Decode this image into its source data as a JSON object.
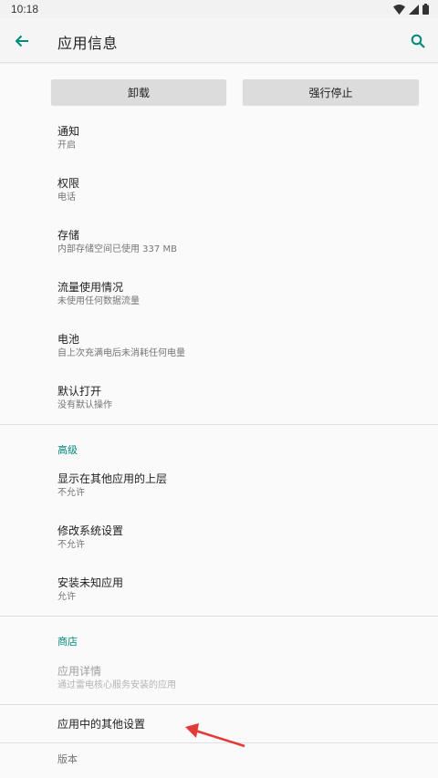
{
  "status_bar": {
    "time": "10:18"
  },
  "app_bar": {
    "title": "应用信息"
  },
  "buttons": {
    "uninstall": "卸载",
    "force_stop": "强行停止"
  },
  "items": [
    {
      "title": "通知",
      "subtitle": "开启"
    },
    {
      "title": "权限",
      "subtitle": "电话"
    },
    {
      "title": "存储",
      "subtitle": "内部存储空间已使用 337 MB"
    },
    {
      "title": "流量使用情况",
      "subtitle": "未使用任何数据流量"
    },
    {
      "title": "电池",
      "subtitle": "自上次充满电后未消耗任何电量"
    },
    {
      "title": "默认打开",
      "subtitle": "没有默认操作"
    }
  ],
  "advanced": {
    "header": "高级",
    "items": [
      {
        "title": "显示在其他应用的上层",
        "subtitle": "不允许"
      },
      {
        "title": "修改系统设置",
        "subtitle": "不允许"
      },
      {
        "title": "安装未知应用",
        "subtitle": "允许"
      }
    ]
  },
  "store": {
    "header": "商店",
    "app_details": {
      "title": "应用详情",
      "subtitle": "通过雷电核心服务安装的应用"
    }
  },
  "other_settings": "应用中的其他设置",
  "version_label": "版本",
  "colors": {
    "accent": "#00897b",
    "annotation": "#e53935"
  },
  "icons": {
    "back": "arrow-left-icon",
    "search": "search-icon",
    "wifi": "wifi-icon",
    "signal": "signal-icon",
    "battery": "battery-icon"
  }
}
